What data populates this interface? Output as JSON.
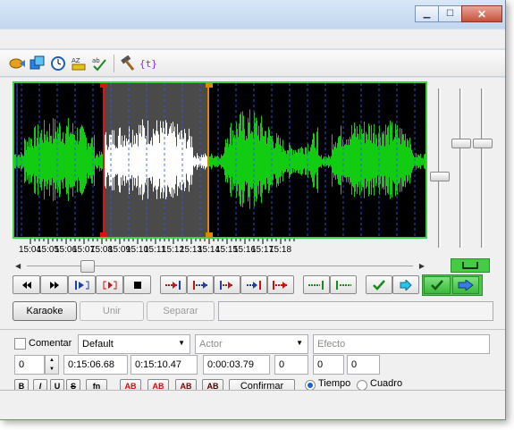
{
  "window": {
    "caption_buttons": [
      "minimize",
      "maximize",
      "close"
    ]
  },
  "toolbar": {
    "icons": [
      "video-icon",
      "style-icon",
      "clock-icon",
      "sort-icon",
      "spellcheck-icon",
      "hammer-icon",
      "automation-icon"
    ]
  },
  "audio": {
    "tick_labels": [
      "15:04",
      "15:05",
      "15:06",
      "15:07",
      "15:08",
      "15:09",
      "15:10",
      "15:11",
      "15:12",
      "15:13",
      "15:14",
      "15:15",
      "15:16",
      "15:17",
      "15:18"
    ],
    "colors": {
      "background": "#000000",
      "waveform": "#11cc11",
      "selection_waveform": "#ffffff",
      "selection_bg": "#4a4a4a",
      "start_marker": "#dd1111",
      "end_marker": "#dd8800",
      "gridline": "#3355ff",
      "frame": "#3ed23e"
    }
  },
  "playback": {
    "buttons": [
      "previous-line",
      "next-line",
      "play-selection",
      "play-current-line",
      "stop",
      "play-500ms-before",
      "play-500ms-after",
      "play-first-500ms",
      "play-last-500ms",
      "play-to-end",
      "lead-in",
      "lead-out",
      "commit",
      "go-to-next"
    ]
  },
  "karaoke_row": {
    "karaoke_label": "Karaoke",
    "join_label": "Unir",
    "split_label": "Separar"
  },
  "edit": {
    "comment_label": "Comentar",
    "style_value": "Default",
    "actor_placeholder": "Actor",
    "effect_placeholder": "Efecto",
    "layer_value": "0",
    "start_time": "0:15:06.68",
    "end_time": "0:15:10.47",
    "duration": "0:00:03.79",
    "margin_left": "0",
    "margin_right": "0",
    "margin_vertical": "0",
    "format_buttons": [
      "B",
      "I",
      "U",
      "S",
      "fn"
    ],
    "color_buttons": [
      "AB",
      "AB",
      "AB",
      "AB"
    ],
    "commit_label": "Confirmar",
    "time_label": "Tiempo",
    "frame_label": "Cuadro"
  }
}
